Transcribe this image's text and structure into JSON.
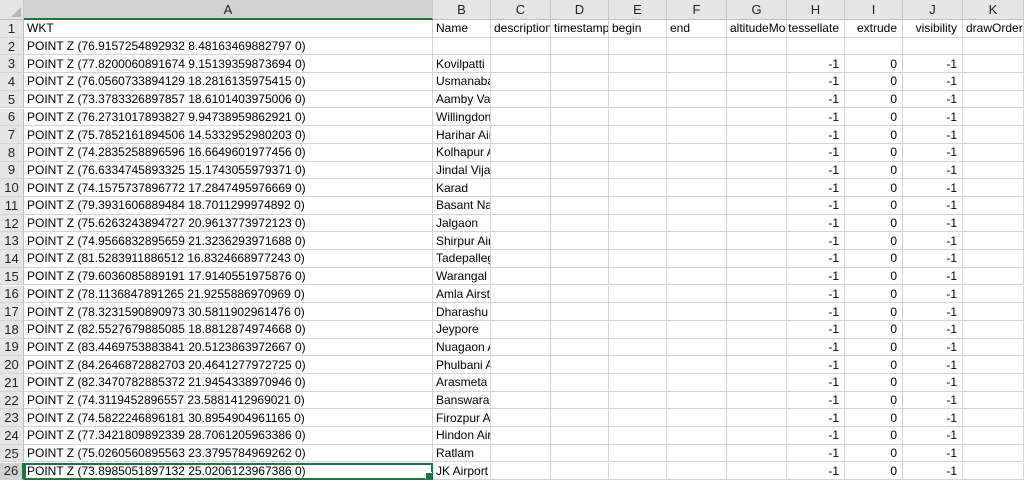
{
  "columns": [
    "A",
    "B",
    "C",
    "D",
    "E",
    "F",
    "G",
    "H",
    "I",
    "J",
    "K"
  ],
  "header_fields": [
    "WKT",
    "Name",
    "description",
    "timestamp",
    "begin",
    "end",
    "altitudeMode",
    "tessellate",
    "extrude",
    "visibility",
    "drawOrder"
  ],
  "rows": [
    {
      "num": "2",
      "wkt": "POINT Z (76.9157254892932 8.48163469882797 0)",
      "name": "",
      "tess": "",
      "ext": "",
      "vis": ""
    },
    {
      "num": "3",
      "wkt": "POINT Z (77.8200060891674 9.15139359873694 0)",
      "name": "Kovilpatti",
      "tess": "-1",
      "ext": "0",
      "vis": "-1"
    },
    {
      "num": "4",
      "wkt": "POINT Z (76.0560733894129 18.2816135975415 0)",
      "name": "Usmanabad",
      "tess": "-1",
      "ext": "0",
      "vis": "-1"
    },
    {
      "num": "5",
      "wkt": "POINT Z (73.3783326897857 18.6101403975006 0)",
      "name": "Aamby Valley Airfield",
      "tess": "-1",
      "ext": "0",
      "vis": "-1"
    },
    {
      "num": "6",
      "wkt": "POINT Z (76.2731017893827 9.94738959862921 0)",
      "name": "Willingdon Island Air Base",
      "tess": "-1",
      "ext": "0",
      "vis": "-1"
    },
    {
      "num": "7",
      "wkt": "POINT Z (75.7852161894506 14.5332952980203 0)",
      "name": "Harihar Airstrip",
      "tess": "-1",
      "ext": "0",
      "vis": "-1"
    },
    {
      "num": "8",
      "wkt": "POINT Z (74.2835258896596 16.6649601977456 0)",
      "name": "Kolhapur Airport",
      "tess": "-1",
      "ext": "0",
      "vis": "-1"
    },
    {
      "num": "9",
      "wkt": "POINT Z (76.6334745893325 15.1743055979371 0)",
      "name": "Jindal Vijaynagar Airport",
      "tess": "-1",
      "ext": "0",
      "vis": "-1"
    },
    {
      "num": "10",
      "wkt": "POINT Z (74.1575737896772 17.2847495976669 0)",
      "name": "Karad",
      "tess": "-1",
      "ext": "0",
      "vis": "-1"
    },
    {
      "num": "11",
      "wkt": "POINT Z (79.3931606889484 18.7011299974892 0)",
      "name": "Basant Nagar Airstrip",
      "tess": "-1",
      "ext": "0",
      "vis": "-1"
    },
    {
      "num": "12",
      "wkt": "POINT Z (75.6263243894727 20.9613773972123 0)",
      "name": "Jalgaon",
      "tess": "-1",
      "ext": "0",
      "vis": "-1"
    },
    {
      "num": "13",
      "wkt": "POINT Z (74.9566832895659 21.3236293971688 0)",
      "name": "Shirpur Airfield",
      "tess": "-1",
      "ext": "0",
      "vis": "-1"
    },
    {
      "num": "14",
      "wkt": "POINT Z (81.5283911886512 16.8324668977243 0)",
      "name": "Tadepallegudem Airstrip",
      "tess": "-1",
      "ext": "0",
      "vis": "-1"
    },
    {
      "num": "15",
      "wkt": "POINT Z (79.6036085889191 17.9140551975876 0)",
      "name": "Warangal",
      "tess": "-1",
      "ext": "0",
      "vis": "-1"
    },
    {
      "num": "16",
      "wkt": "POINT Z (78.1136847891265 21.9255886970969 0)",
      "name": "Amla Airstrip",
      "tess": "-1",
      "ext": "0",
      "vis": "-1"
    },
    {
      "num": "17",
      "wkt": "POINT Z (78.3231590890973 30.5811902961476 0)",
      "name": "Dharashu Airstrip",
      "tess": "-1",
      "ext": "0",
      "vis": "-1"
    },
    {
      "num": "18",
      "wkt": "POINT Z (82.5527679885085 18.8812874974668 0)",
      "name": "Jeypore",
      "tess": "-1",
      "ext": "0",
      "vis": "-1"
    },
    {
      "num": "19",
      "wkt": "POINT Z (83.4469753883841 20.5123863972667 0)",
      "name": "Nuagaon Airstrip",
      "tess": "-1",
      "ext": "0",
      "vis": "-1"
    },
    {
      "num": "20",
      "wkt": "POINT Z (84.2646872882703 20.4641277972725 0)",
      "name": "Phulbani Airstrip",
      "tess": "-1",
      "ext": "0",
      "vis": "-1"
    },
    {
      "num": "21",
      "wkt": "POINT Z (82.3470782885372 21.9454338970946 0)",
      "name": "Arasmeta Airstrip",
      "tess": "-1",
      "ext": "0",
      "vis": "-1"
    },
    {
      "num": "22",
      "wkt": "POINT Z (74.3119452896557 23.5881412969021 0)",
      "name": "Banswara Airstrip",
      "tess": "-1",
      "ext": "0",
      "vis": "-1"
    },
    {
      "num": "23",
      "wkt": "POINT Z (74.5822246896181 30.8954904961165 0)",
      "name": "Firozpur Abandoned Airfield",
      "tess": "-1",
      "ext": "0",
      "vis": "-1"
    },
    {
      "num": "24",
      "wkt": "POINT Z (77.3421809892339 28.7061205963386 0)",
      "name": "Hindon Airport",
      "tess": "-1",
      "ext": "0",
      "vis": "-1"
    },
    {
      "num": "25",
      "wkt": "POINT Z (75.0260560895563 23.3795784969262 0)",
      "name": "Ratlam",
      "tess": "-1",
      "ext": "0",
      "vis": "-1"
    },
    {
      "num": "26",
      "wkt": "POINT Z (73.8985051897132 25.0206123967386 0)",
      "name": "JK Airport",
      "tess": "-1",
      "ext": "0",
      "vis": "-1"
    }
  ],
  "active_cell": "A26",
  "colors": {
    "accent": "#217346",
    "header_bg": "#e6e6e6",
    "gridline": "#d4d4d4"
  }
}
